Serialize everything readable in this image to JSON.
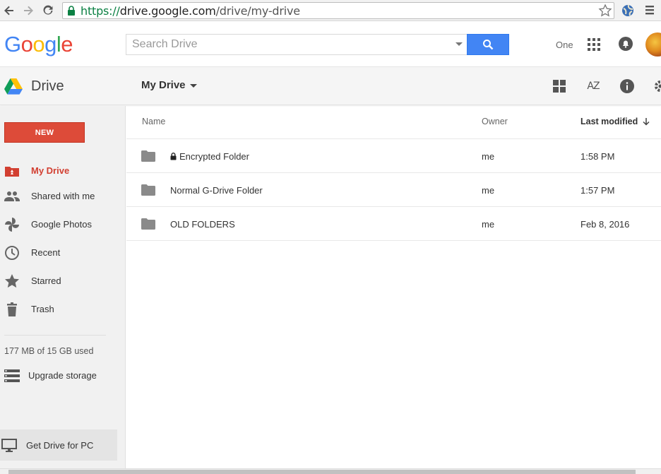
{
  "browser": {
    "url_scheme": "https://",
    "url_host": "drive.google.com",
    "url_path": "/drive/my-drive"
  },
  "header": {
    "logo": [
      "G",
      "o",
      "o",
      "g",
      "l",
      "e"
    ],
    "logo_colors": [
      "#4285f4",
      "#ea4335",
      "#fbbc05",
      "#4285f4",
      "#34a853",
      "#ea4335"
    ],
    "search_placeholder": "Search Drive",
    "account_name": "One"
  },
  "toolbar": {
    "product": "Drive",
    "location": "My Drive",
    "sort_icon_label": "AZ"
  },
  "sidebar": {
    "new_label": "NEW",
    "items": [
      {
        "label": "My Drive",
        "icon": "my-drive-icon",
        "active": true
      },
      {
        "label": "Shared with me",
        "icon": "people-icon",
        "active": false
      },
      {
        "label": "Google Photos",
        "icon": "pinwheel-icon",
        "active": false
      },
      {
        "label": "Recent",
        "icon": "clock-icon",
        "active": false
      },
      {
        "label": "Starred",
        "icon": "star-icon",
        "active": false
      },
      {
        "label": "Trash",
        "icon": "trash-icon",
        "active": false
      }
    ],
    "storage": "177 MB of 15 GB used",
    "upgrade_label": "Upgrade storage",
    "get_drive_label": "Get Drive for PC"
  },
  "file_list": {
    "columns": {
      "name": "Name",
      "owner": "Owner",
      "modified": "Last modified"
    },
    "rows": [
      {
        "name": "Encrypted Folder",
        "locked": true,
        "owner": "me",
        "modified": "1:58 PM"
      },
      {
        "name": "Normal G-Drive Folder",
        "locked": false,
        "owner": "me",
        "modified": "1:57 PM"
      },
      {
        "name": "OLD FOLDERS",
        "locked": false,
        "owner": "me",
        "modified": "Feb 8, 2016"
      }
    ]
  },
  "colors": {
    "accent_red": "#dd4b39",
    "active_text": "#d23f31",
    "search_blue": "#4285f4"
  }
}
